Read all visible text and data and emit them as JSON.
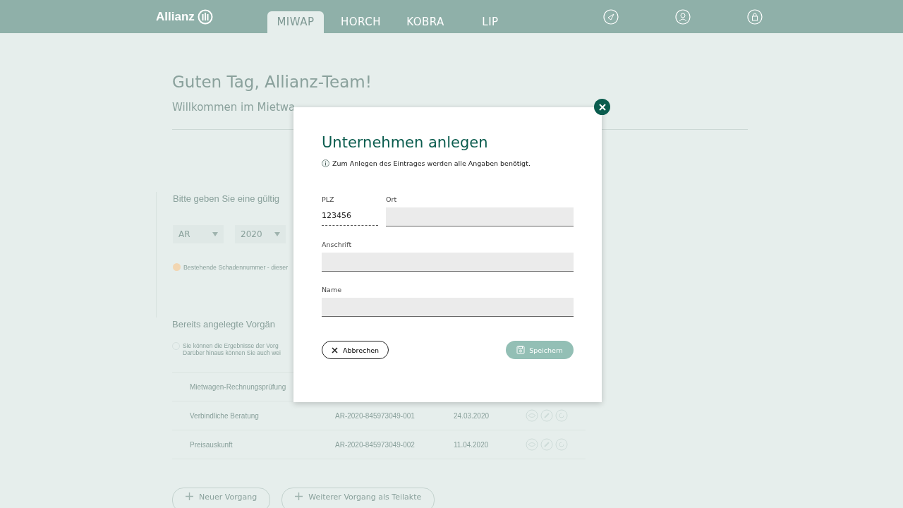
{
  "header": {
    "logo": "Allianz",
    "tabs": [
      {
        "label": "MIWAP",
        "selected": true
      },
      {
        "label": "HORCH",
        "selected": false
      },
      {
        "label": "KOBRA",
        "selected": false
      },
      {
        "label": "LIP",
        "selected": false
      }
    ]
  },
  "page": {
    "greeting": "Guten Tag, Allianz-Team!",
    "welcome": "Willkommen im Mietwa",
    "search_heading": "Bitte geben Sie eine gültig",
    "selects": [
      {
        "value": "AR"
      },
      {
        "value": "2020"
      }
    ],
    "warning": "Bestehende Schadennummer - dieser",
    "cases_heading": "Bereits angelegte Vorgän",
    "cases_info": [
      "Sie können die Ergebnisse der Vorg",
      "Darüber hinaus können Sie auch wei"
    ],
    "rows": [
      {
        "name": "Mietwagen-Rechnungsprüfung"
      },
      {
        "name": "Verbindliche Beratung",
        "number": "AR-2020-845973049-001",
        "date": "24.03.2020"
      },
      {
        "name": "Preisauskunft",
        "number": "AR-2020-845973049-002",
        "date": "11.04.2020"
      }
    ],
    "buttons": [
      "Neuer Vorgang",
      "Weiterer Vorgang als Teilakte"
    ]
  },
  "dialog": {
    "title": "Unternehmen anlegen",
    "info": "Zum Anlegen des Eintrages werden alle Angaben benötigt.",
    "fields": [
      {
        "label": "PLZ",
        "value": "123456",
        "kind": "dotted"
      },
      {
        "label": "Ort",
        "kind": "box"
      },
      {
        "label": "Anschrift",
        "kind": "box"
      },
      {
        "label": "Name",
        "kind": "box"
      }
    ],
    "cancel": "Abbrechen",
    "save": "Speichern",
    "save_disabled": true
  }
}
